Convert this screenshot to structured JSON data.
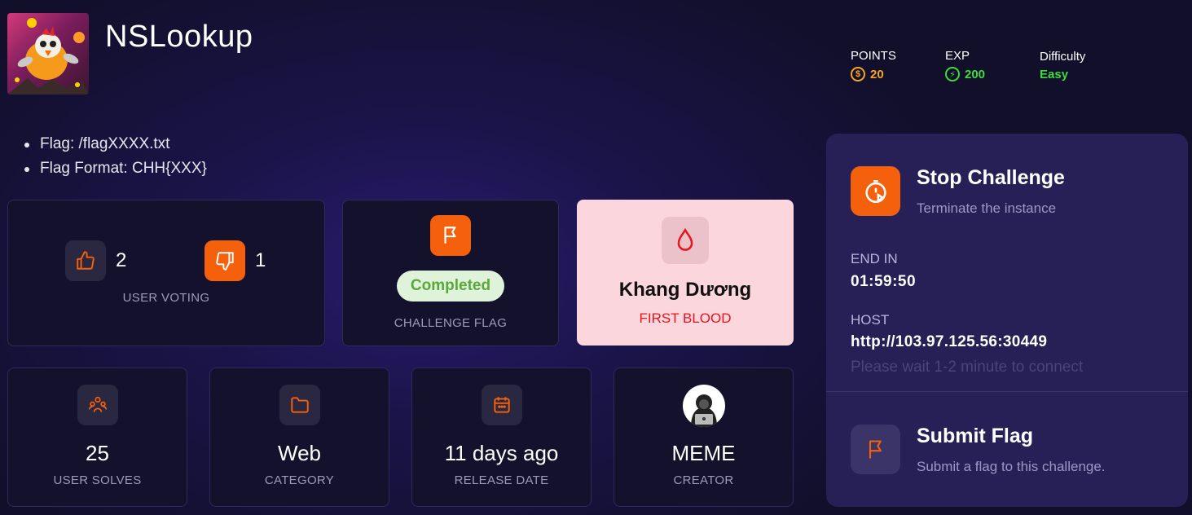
{
  "challenge": {
    "title": "NSLookup"
  },
  "stats": {
    "points": {
      "label": "POINTS",
      "value": "20",
      "color": "#f5a623"
    },
    "exp": {
      "label": "EXP",
      "value": "200",
      "color": "#3ddc3d"
    },
    "difficulty": {
      "label": "Difficulty",
      "value": "Easy",
      "color": "#3ddc3d"
    }
  },
  "description": [
    "Flag: /flagXXXX.txt",
    "Flag Format: CHH{XXX}"
  ],
  "voting": {
    "up_count": "2",
    "down_count": "1",
    "caption": "USER VOTING"
  },
  "flag_card": {
    "status": "Completed",
    "caption": "CHALLENGE FLAG"
  },
  "first_blood": {
    "name": "Khang Dương",
    "caption": "FIRST BLOOD"
  },
  "info_cards": [
    {
      "value": "25",
      "caption": "USER SOLVES",
      "icon": "users-icon"
    },
    {
      "value": "Web",
      "caption": "CATEGORY",
      "icon": "folder-icon"
    },
    {
      "value": "11 days ago",
      "caption": "RELEASE DATE",
      "icon": "calendar-icon"
    },
    {
      "value": "MEME",
      "caption": "CREATOR",
      "icon": "hacker-avatar"
    }
  ],
  "panel": {
    "stop": {
      "title": "Stop Challenge",
      "subtitle": "Terminate the instance"
    },
    "end_in": {
      "label": "END IN",
      "value": "01:59:50"
    },
    "host": {
      "label": "HOST",
      "value": "http://103.97.125.56:30449",
      "hint": "Please wait 1-2 minute to connect"
    },
    "submit": {
      "title": "Submit Flag",
      "subtitle": "Submit a flag to this challenge."
    }
  },
  "colors": {
    "accent": "#f5600c",
    "first_blood_bg": "#fbd6dc",
    "first_blood_red": "#e8141e",
    "completed_green": "#5aa83c"
  }
}
